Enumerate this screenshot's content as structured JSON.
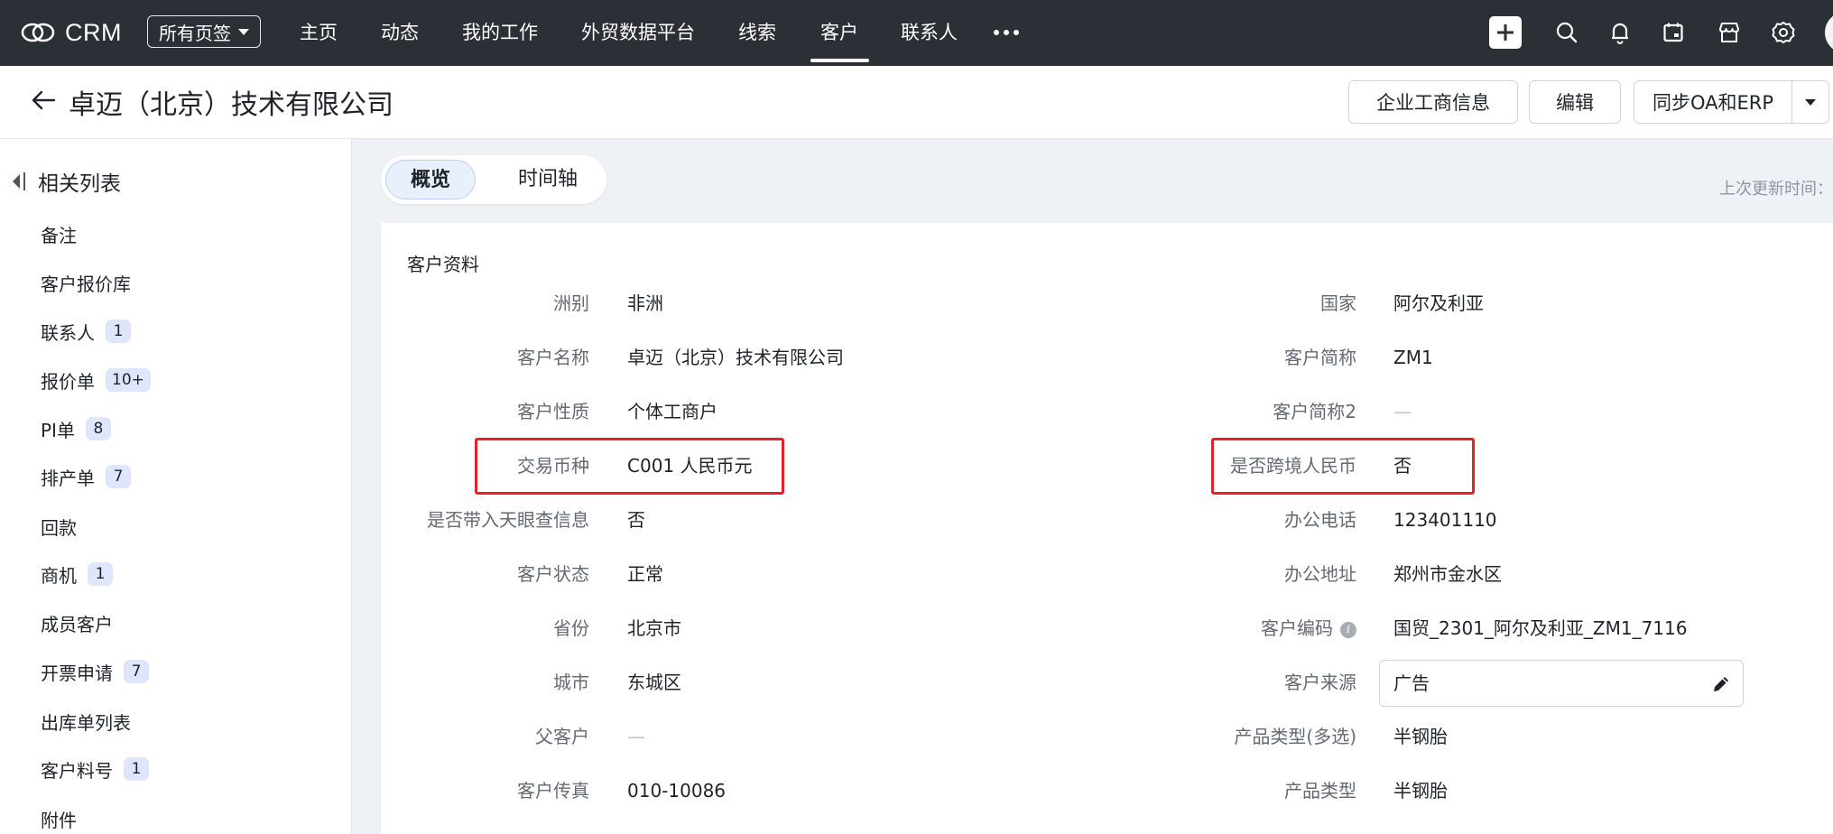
{
  "app": {
    "brand": "CRM",
    "tag_selector": "所有页签",
    "nav": [
      "主页",
      "动态",
      "我的工作",
      "外贸数据平台",
      "线索",
      "客户",
      "联系人"
    ],
    "active_nav": "客户",
    "icons": [
      "plus-icon",
      "search-icon",
      "bell-icon",
      "calendar-icon",
      "store-icon",
      "gear-icon"
    ]
  },
  "header": {
    "title": "卓迈（北京）技术有限公司",
    "buttons": {
      "business_info": "企业工商信息",
      "edit": "编辑",
      "sync": "同步OA和ERP"
    }
  },
  "sidebar": {
    "title": "相关列表",
    "items": [
      {
        "label": "备注",
        "count": null
      },
      {
        "label": "客户报价库",
        "count": null
      },
      {
        "label": "联系人",
        "count": "1"
      },
      {
        "label": "报价单",
        "count": "10+"
      },
      {
        "label": "PI单",
        "count": "8"
      },
      {
        "label": "排产单",
        "count": "7"
      },
      {
        "label": "回款",
        "count": null
      },
      {
        "label": "商机",
        "count": "1"
      },
      {
        "label": "成员客户",
        "count": null
      },
      {
        "label": "开票申请",
        "count": "7"
      },
      {
        "label": "出库单列表",
        "count": null
      },
      {
        "label": "客户料号",
        "count": "1"
      },
      {
        "label": "附件",
        "count": null
      }
    ]
  },
  "tabs": {
    "overview": "概览",
    "timeline": "时间轴",
    "last_update": "上次更新时间："
  },
  "section": {
    "title": "客户资料",
    "left": [
      {
        "label": "洲别",
        "value": "非洲"
      },
      {
        "label": "客户名称",
        "value": "卓迈（北京）技术有限公司"
      },
      {
        "label": "客户性质",
        "value": "个体工商户"
      },
      {
        "label": "交易币种",
        "value": "C001 人民币元"
      },
      {
        "label": "是否带入天眼查信息",
        "value": "否"
      },
      {
        "label": "客户状态",
        "value": "正常"
      },
      {
        "label": "省份",
        "value": "北京市"
      },
      {
        "label": "城市",
        "value": "东城区"
      },
      {
        "label": "父客户",
        "value": "—"
      },
      {
        "label": "客户传真",
        "value": "010-10086"
      }
    ],
    "right": [
      {
        "label": "国家",
        "value": "阿尔及利亚"
      },
      {
        "label": "客户简称",
        "value": "ZM1"
      },
      {
        "label": "客户简称2",
        "value": "—"
      },
      {
        "label": "是否跨境人民币",
        "value": "否"
      },
      {
        "label": "办公电话",
        "value": "123401110"
      },
      {
        "label": "办公地址",
        "value": "郑州市金水区"
      },
      {
        "label": "客户编码",
        "value": "国贸_2301_阿尔及利亚_ZM1_7116",
        "info_icon": "i"
      },
      {
        "label": "客户来源",
        "value": "广告"
      },
      {
        "label": "产品类型(多选)",
        "value": "半钢胎"
      },
      {
        "label": "产品类型",
        "value": "半钢胎"
      }
    ]
  },
  "colors": {
    "topbar": "#2b2f36",
    "highlight": "#e8202a",
    "badge": "#dde6fb",
    "content_bg": "#eef1f5"
  }
}
